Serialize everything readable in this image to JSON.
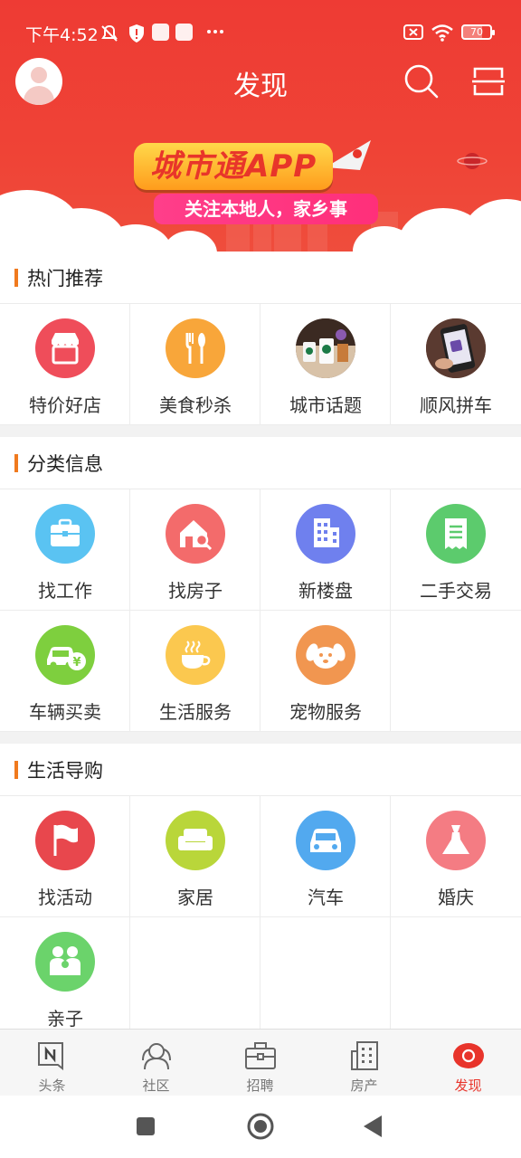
{
  "status_bar": {
    "time": "下午4:52",
    "battery": "70"
  },
  "nav": {
    "title": "发现"
  },
  "banner": {
    "title": "城市通APP",
    "subtitle": "关注本地人，家乡事"
  },
  "sections": [
    {
      "title": "热门推荐",
      "items": [
        {
          "label": "特价好店",
          "icon": "shop-icon",
          "color": "#ef4d5a"
        },
        {
          "label": "美食秒杀",
          "icon": "fork-knife-icon",
          "color": "#f8a63a"
        },
        {
          "label": "城市话题",
          "icon": "coffee-photo-icon",
          "color": "#6b4a3a"
        },
        {
          "label": "顺风拼车",
          "icon": "phone-photo-icon",
          "color": "#7a4a3a"
        }
      ]
    },
    {
      "title": "分类信息",
      "items": [
        {
          "label": "找工作",
          "icon": "briefcase-icon",
          "color": "#5ac3f2"
        },
        {
          "label": "找房子",
          "icon": "house-search-icon",
          "color": "#f36b6b"
        },
        {
          "label": "新楼盘",
          "icon": "building-icon",
          "color": "#6f80ee"
        },
        {
          "label": "二手交易",
          "icon": "receipt-icon",
          "color": "#5ccb6d"
        },
        {
          "label": "车辆买卖",
          "icon": "car-yen-icon",
          "color": "#7ecf3e"
        },
        {
          "label": "生活服务",
          "icon": "cup-icon",
          "color": "#fbc84f"
        },
        {
          "label": "宠物服务",
          "icon": "dog-icon",
          "color": "#f19650"
        }
      ]
    },
    {
      "title": "生活导购",
      "items": [
        {
          "label": "找活动",
          "icon": "flag-icon",
          "color": "#e8474d"
        },
        {
          "label": "家居",
          "icon": "sofa-icon",
          "color": "#b9d63a"
        },
        {
          "label": "汽车",
          "icon": "car-icon",
          "color": "#52a9ef"
        },
        {
          "label": "婚庆",
          "icon": "dress-icon",
          "color": "#f47c83"
        },
        {
          "label": "亲子",
          "icon": "family-icon",
          "color": "#6bd36b"
        }
      ]
    }
  ],
  "tabbar": {
    "items": [
      {
        "label": "头条",
        "icon": "news-icon"
      },
      {
        "label": "社区",
        "icon": "community-icon"
      },
      {
        "label": "招聘",
        "icon": "job-icon"
      },
      {
        "label": "房产",
        "icon": "building-tab-icon"
      },
      {
        "label": "发现",
        "icon": "discover-icon",
        "active": true
      }
    ],
    "active_color": "#e8342b"
  }
}
